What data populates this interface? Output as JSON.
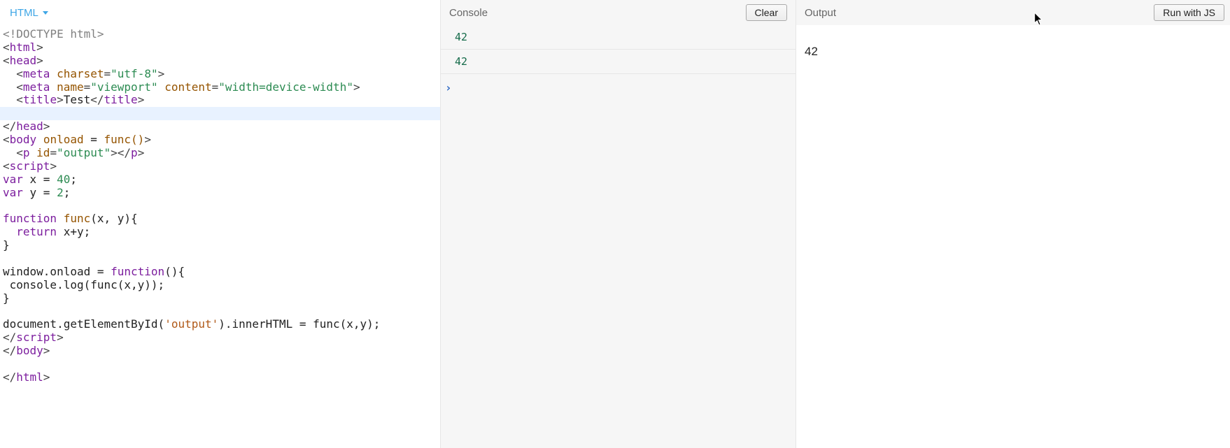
{
  "editor": {
    "tab_label": "HTML",
    "code_tokens": [
      [
        {
          "c": "decl",
          "t": "<!DOCTYPE html>"
        }
      ],
      [
        {
          "c": "punct",
          "t": "<"
        },
        {
          "c": "tag",
          "t": "html"
        },
        {
          "c": "punct",
          "t": ">"
        }
      ],
      [
        {
          "c": "punct",
          "t": "<"
        },
        {
          "c": "tag",
          "t": "head"
        },
        {
          "c": "punct",
          "t": ">"
        }
      ],
      [
        {
          "c": "txt",
          "t": "  "
        },
        {
          "c": "punct",
          "t": "<"
        },
        {
          "c": "tag",
          "t": "meta "
        },
        {
          "c": "attr",
          "t": "charset"
        },
        {
          "c": "punct",
          "t": "="
        },
        {
          "c": "val",
          "t": "\"utf-8\""
        },
        {
          "c": "punct",
          "t": ">"
        }
      ],
      [
        {
          "c": "txt",
          "t": "  "
        },
        {
          "c": "punct",
          "t": "<"
        },
        {
          "c": "tag",
          "t": "meta "
        },
        {
          "c": "attr",
          "t": "name"
        },
        {
          "c": "punct",
          "t": "="
        },
        {
          "c": "val",
          "t": "\"viewport\""
        },
        {
          "c": "txt",
          "t": " "
        },
        {
          "c": "attr",
          "t": "content"
        },
        {
          "c": "punct",
          "t": "="
        },
        {
          "c": "val",
          "t": "\"width=device-width\""
        },
        {
          "c": "punct",
          "t": ">"
        }
      ],
      [
        {
          "c": "txt",
          "t": "  "
        },
        {
          "c": "punct",
          "t": "<"
        },
        {
          "c": "tag",
          "t": "title"
        },
        {
          "c": "punct",
          "t": ">"
        },
        {
          "c": "txt",
          "t": "Test"
        },
        {
          "c": "punct",
          "t": "</"
        },
        {
          "c": "tag",
          "t": "title"
        },
        {
          "c": "punct",
          "t": ">"
        }
      ],
      "HL_BLANK",
      [
        {
          "c": "punct",
          "t": "</"
        },
        {
          "c": "tag",
          "t": "head"
        },
        {
          "c": "punct",
          "t": ">"
        }
      ],
      [
        {
          "c": "punct",
          "t": "<"
        },
        {
          "c": "tag",
          "t": "body "
        },
        {
          "c": "attr",
          "t": "onload"
        },
        {
          "c": "txt",
          "t": " = "
        },
        {
          "c": "attr",
          "t": "func()"
        },
        {
          "c": "punct",
          "t": ">"
        }
      ],
      [
        {
          "c": "txt",
          "t": "  "
        },
        {
          "c": "punct",
          "t": "<"
        },
        {
          "c": "tag",
          "t": "p "
        },
        {
          "c": "attr",
          "t": "id"
        },
        {
          "c": "punct",
          "t": "="
        },
        {
          "c": "val",
          "t": "\"output\""
        },
        {
          "c": "punct",
          "t": "></"
        },
        {
          "c": "tag",
          "t": "p"
        },
        {
          "c": "punct",
          "t": ">"
        }
      ],
      [
        {
          "c": "punct",
          "t": "<"
        },
        {
          "c": "tag",
          "t": "script"
        },
        {
          "c": "punct",
          "t": ">"
        }
      ],
      [
        {
          "c": "kw",
          "t": "var"
        },
        {
          "c": "txt",
          "t": " x = "
        },
        {
          "c": "num",
          "t": "40"
        },
        {
          "c": "txt",
          "t": ";"
        }
      ],
      [
        {
          "c": "kw",
          "t": "var"
        },
        {
          "c": "txt",
          "t": " y = "
        },
        {
          "c": "num",
          "t": "2"
        },
        {
          "c": "txt",
          "t": ";"
        }
      ],
      "BLANK",
      [
        {
          "c": "kw",
          "t": "function "
        },
        {
          "c": "fn",
          "t": "func"
        },
        {
          "c": "txt",
          "t": "(x, y){"
        }
      ],
      [
        {
          "c": "txt",
          "t": "  "
        },
        {
          "c": "kw",
          "t": "return"
        },
        {
          "c": "txt",
          "t": " x+y;"
        }
      ],
      [
        {
          "c": "txt",
          "t": "}"
        }
      ],
      "BLANK",
      [
        {
          "c": "txt",
          "t": "window.onload = "
        },
        {
          "c": "kw",
          "t": "function"
        },
        {
          "c": "txt",
          "t": "(){"
        }
      ],
      [
        {
          "c": "txt",
          "t": " console.log(func(x,y));"
        }
      ],
      [
        {
          "c": "txt",
          "t": "}"
        }
      ],
      "BLANK",
      [
        {
          "c": "txt",
          "t": "document.getElementById("
        },
        {
          "c": "str",
          "t": "'output'"
        },
        {
          "c": "txt",
          "t": ").innerHTML = func(x,y);"
        }
      ],
      [
        {
          "c": "punct",
          "t": "</"
        },
        {
          "c": "tag",
          "t": "script"
        },
        {
          "c": "punct",
          "t": ">"
        }
      ],
      [
        {
          "c": "punct",
          "t": "</"
        },
        {
          "c": "tag",
          "t": "body"
        },
        {
          "c": "punct",
          "t": ">"
        }
      ],
      "BLANK",
      [
        {
          "c": "punct",
          "t": "</"
        },
        {
          "c": "tag",
          "t": "html"
        },
        {
          "c": "punct",
          "t": ">"
        }
      ]
    ]
  },
  "console": {
    "title": "Console",
    "clear_label": "Clear",
    "lines": [
      "42",
      "42"
    ],
    "prompt": "›"
  },
  "output": {
    "title": "Output",
    "run_label": "Run with JS",
    "body": "42"
  }
}
